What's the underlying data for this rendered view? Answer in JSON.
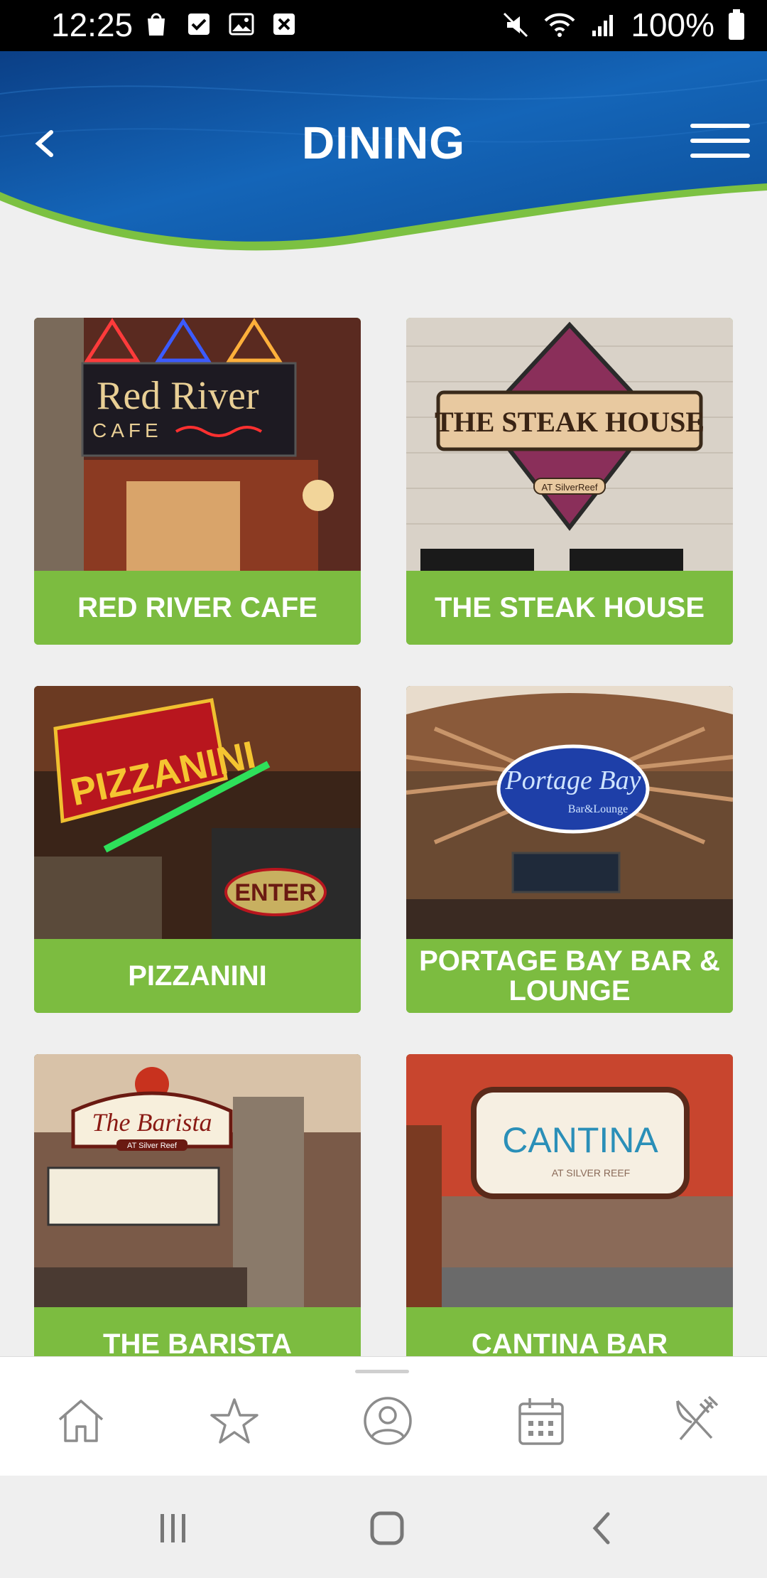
{
  "status_bar": {
    "time": "12:25",
    "battery": "100%",
    "left_icons": [
      "shopping-bag-icon",
      "checkbox-icon",
      "image-icon",
      "close-box-icon"
    ],
    "right_icons": [
      "mute-icon",
      "wifi-icon",
      "signal-icon",
      "battery-icon"
    ]
  },
  "header": {
    "title": "DINING",
    "back_icon": "chevron-left-icon",
    "menu_icon": "hamburger-menu-icon"
  },
  "venues": [
    {
      "name": "RED RIVER CAFE",
      "sign": "Red River",
      "sign_sub": "CAFE"
    },
    {
      "name": "THE STEAK HOUSE",
      "sign": "THE STEAK HOUSE",
      "sign_sub": "AT SilverReef"
    },
    {
      "name": "PIZZANINI",
      "sign": "PIZZANINI",
      "sign_sub": "ENTER"
    },
    {
      "name": "PORTAGE BAY BAR & LOUNGE",
      "sign": "Portage Bay",
      "sign_sub": "Bar&Lounge"
    },
    {
      "name": "THE BARISTA",
      "sign": "The Barista",
      "sign_sub": "AT Silver Reef"
    },
    {
      "name": "CANTINA BAR",
      "sign": "CANTINA",
      "sign_sub": "AT SILVER REEF"
    }
  ],
  "bottom_nav": [
    "home-icon",
    "star-icon",
    "profile-icon",
    "calendar-icon",
    "dining-utensils-icon"
  ],
  "system_nav": [
    "recent-apps-icon",
    "home-button-icon",
    "back-icon"
  ],
  "colors": {
    "header_blue": "#0d4f9a",
    "accent_green": "#7cbc40",
    "nav_icon": "#8c8c8c"
  }
}
